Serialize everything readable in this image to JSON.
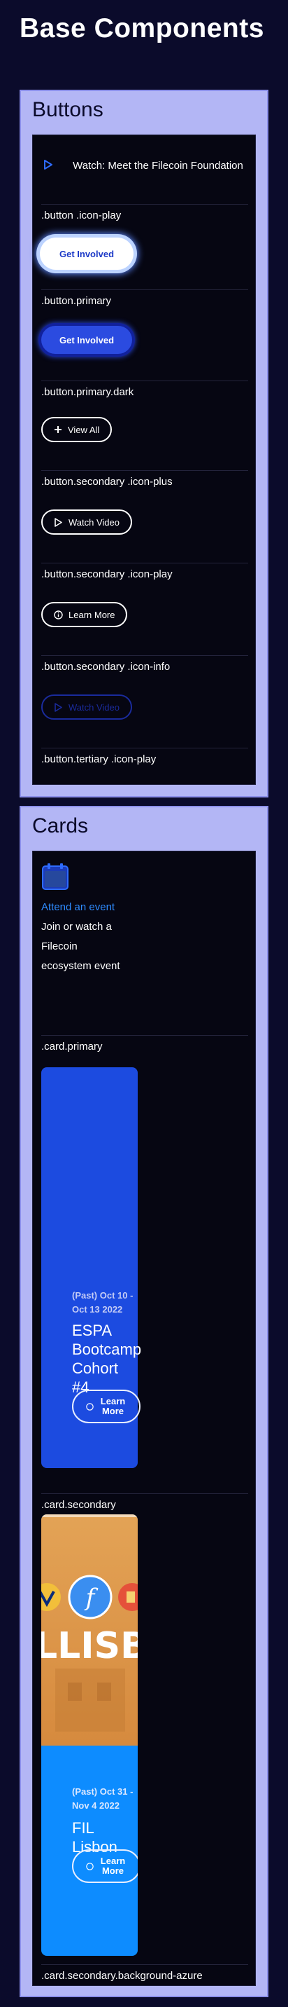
{
  "page": {
    "title": "Base Components"
  },
  "buttons_section": {
    "title": "Buttons",
    "watch_label": "Watch: Meet the Filecoin Foundation",
    "items": [
      {
        "caption": ".button .icon-play",
        "label": "Get Involved"
      },
      {
        "caption": ".button.primary",
        "label": "Get Involved"
      },
      {
        "caption": ".button.primary.dark",
        "label": "View All"
      },
      {
        "caption": ".button.secondary .icon-plus",
        "label": "Watch Video"
      },
      {
        "caption": ".button.secondary .icon-play",
        "label": "Learn More"
      },
      {
        "caption": ".button.secondary .icon-info",
        "label": "Watch Video"
      },
      {
        "caption": ".button.tertiary .icon-play"
      }
    ]
  },
  "cards_section": {
    "title": "Cards",
    "event_card": {
      "link": "Attend an event",
      "description": "Join or watch a Filecoin ecosystem event",
      "caption": ".card.primary"
    },
    "secondary_card": {
      "date": "(Past) Oct 10 - Oct 13 2022",
      "title": "ESPA Bootcamp Cohort #4",
      "button": "Learn More",
      "caption": ".card.secondary"
    },
    "azure_card": {
      "image_text": "LLISBO",
      "date": "(Past) Oct 31 - Nov 4 2022",
      "title": "FIL Lisbon",
      "button": "Learn More",
      "caption": ".card.secondary.background-azure"
    }
  },
  "colors": {
    "background": "#0b0b2b",
    "section_bg": "#b3b6f5",
    "panel_bg": "#060612",
    "primary_blue": "#1c4be0",
    "azure": "#0d8cff",
    "link_blue": "#2e8bff"
  }
}
